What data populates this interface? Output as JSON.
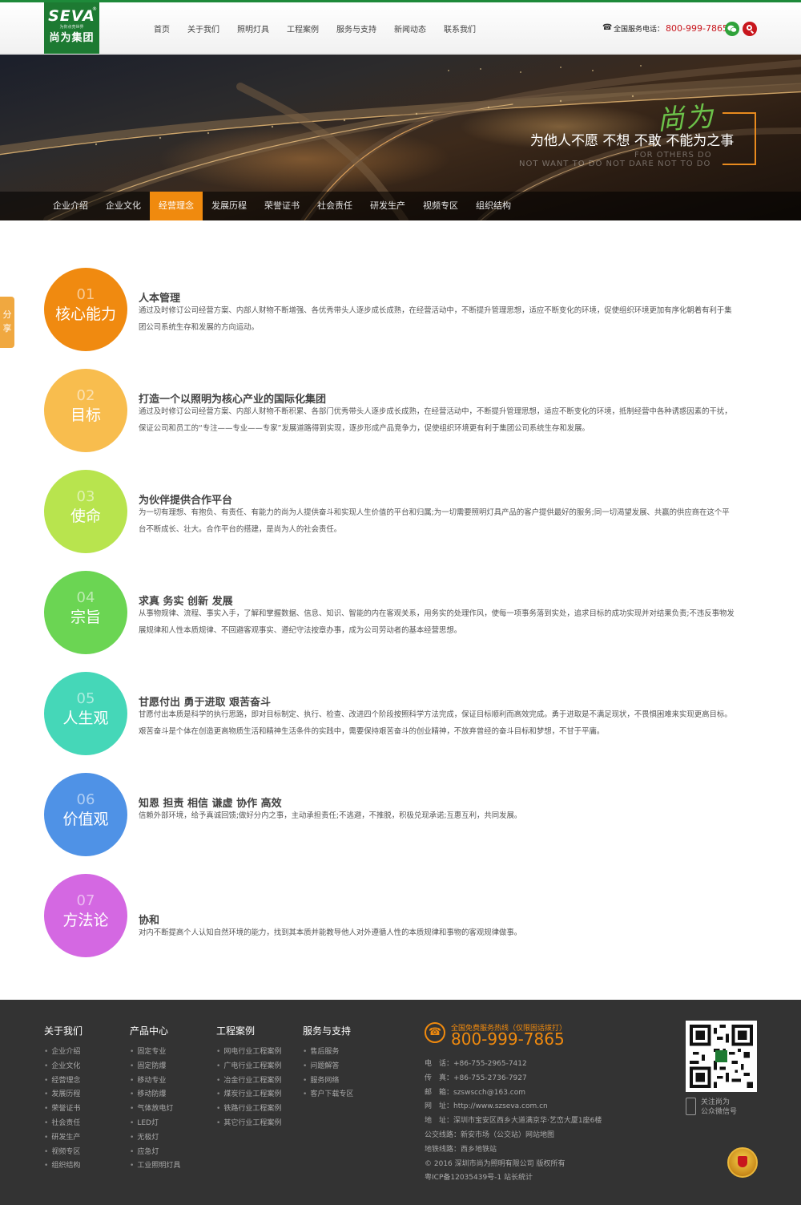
{
  "header": {
    "logo": {
      "brand": "SEVA",
      "tagline": "为你点亮世界",
      "cn_name": "尚为集团"
    },
    "nav": [
      "首页",
      "关于我们",
      "照明灯具",
      "工程案例",
      "服务与支持",
      "新闻动态",
      "联系我们"
    ],
    "phone_label": "全国服务电话：",
    "phone_number": "800-999-7865",
    "icons": {
      "phone": "phone-icon",
      "wechat": "wechat-icon",
      "search": "search-icon"
    }
  },
  "banner": {
    "brand_script": "尚为",
    "slogan": "为他人不愿 不想 不敢 不能为之事",
    "slogan_en_1": "FOR OTHERS DO",
    "slogan_en_2": "NOT WANT TO DO NOT DARE NOT TO DO"
  },
  "subnav": {
    "items": [
      "企业介绍",
      "企业文化",
      "经营理念",
      "发展历程",
      "荣誉证书",
      "社会责任",
      "研发生产",
      "视频专区",
      "组织结构"
    ],
    "active_index": 2,
    "active_color": "#f08a0e"
  },
  "share": {
    "label": "分享"
  },
  "values": [
    {
      "num": "01",
      "name": "核心能力",
      "color": "#f08a10",
      "title": "人本管理",
      "desc": "通过及时修订公司经营方案、内部人财物不断增强、各优秀带头人逐步成长成熟，在经营活动中，不断提升管理思想，适应不断变化的环境，促使组织环境更加有序化朝着有利于集团公司系统生存和发展的方向运动。"
    },
    {
      "num": "02",
      "name": "目标",
      "color": "#f8bd4e",
      "title": "打造一个以照明为核心产业的国际化集团",
      "desc": "通过及时修订公司经营方案、内部人财物不断积累、各部门优秀带头人逐步成长成熟，在经营活动中，不断提升管理思想，适应不断变化的环境，抵制经营中各种诱惑因素的干扰，保证公司和员工的“专注——专业——专家”发展道路得到实现，逐步形成产品竞争力，促使组织环境更有利于集团公司系统生存和发展。"
    },
    {
      "num": "03",
      "name": "使命",
      "color": "#b8e44e",
      "title": "为伙伴提供合作平台",
      "desc": "为一切有理想、有抱负、有责任、有能力的尚为人提供奋斗和实现人生价值的平台和归属;为一切需要照明灯具产品的客户提供最好的服务;同一切渴望发展、共赢的供应商在这个平台不断成长、壮大。合作平台的搭建，是尚为人的社会责任。"
    },
    {
      "num": "04",
      "name": "宗旨",
      "color": "#6bd553",
      "title": "求真 务实 创新 发展",
      "desc": "从事物规律、流程、事实入手，了解和掌握数据、信息、知识、智能的内在客观关系，用务实的处理作风，使每一项事务落到实处，追求目标的成功实现并对结果负责;不违反事物发展规律和人性本质规律、不回避客观事实、遵纪守法按章办事，成为公司劳动者的基本经营思想。"
    },
    {
      "num": "05",
      "name": "人生观",
      "color": "#45d7b8",
      "title": "甘愿付出 勇于进取 艰苦奋斗",
      "desc": "甘愿付出本质是科学的执行思路，即对目标制定、执行、检查、改进四个阶段按照科学方法完成，保证目标顺利而高效完成。勇于进取是不满足现状，不畏惧困难来实现更高目标。艰苦奋斗是个体在创造更高物质生活和精神生活条件的实践中，需要保持艰苦奋斗的创业精神，不放弃曾经的奋斗目标和梦想，不甘于平庸。"
    },
    {
      "num": "06",
      "name": "价值观",
      "color": "#4f92e6",
      "title": "知恩 担责 相信 谦虚 协作 高效",
      "desc": "信赖外部环境，给予真诚回馈;做好分内之事，主动承担责任;不逃避，不推脱，积极兑现承诺;互惠互利，共同发展。"
    },
    {
      "num": "07",
      "name": "方法论",
      "color": "#d468e2",
      "title": "协和",
      "desc": "对内不断提高个人认知自然环境的能力，找到其本质并能教导他人对外遵循人性的本质规律和事物的客观规律做事。"
    }
  ],
  "footer": {
    "columns": [
      {
        "title": "关于我们",
        "items": [
          "企业介绍",
          "企业文化",
          "经营理念",
          "发展历程",
          "荣誉证书",
          "社会责任",
          "研发生产",
          "视频专区",
          "组织结构"
        ]
      },
      {
        "title": "产品中心",
        "items": [
          "固定专业",
          "固定防爆",
          "移动专业",
          "移动防爆",
          "气体放电灯",
          "LED灯",
          "无极灯",
          "应急灯",
          "工业照明灯具"
        ]
      },
      {
        "title": "工程案例",
        "items": [
          "网电行业工程案例",
          "广电行业工程案例",
          "冶金行业工程案例",
          "煤炭行业工程案例",
          "铁路行业工程案例",
          "其它行业工程案例"
        ]
      },
      {
        "title": "服务与支持",
        "items": [
          "售后服务",
          "问题解答",
          "服务网络",
          "客户下载专区"
        ]
      }
    ],
    "hotline_label": "全国免费服务热线（仅限固话拨打）",
    "hotline_number": "800-999-7865",
    "contact": [
      "电　话：+86-755-2965-7412",
      "传　真：+86-755-2736-7927",
      "邮　箱：szswscch@163.com",
      "网　址：http://www.szseva.com.cn",
      "地　址：深圳市宝安区西乡大道满京华·艺峦大厦1座6楼",
      "公交线路：新安市场（公交站）网站地图",
      "地铁线路：西乡地铁站",
      "© 2016 深圳市尚为照明有限公司 版权所有",
      "粤ICP备12035439号-1  站长统计"
    ],
    "qr_caption_1": "关注尚为",
    "qr_caption_2": "公众微信号"
  }
}
